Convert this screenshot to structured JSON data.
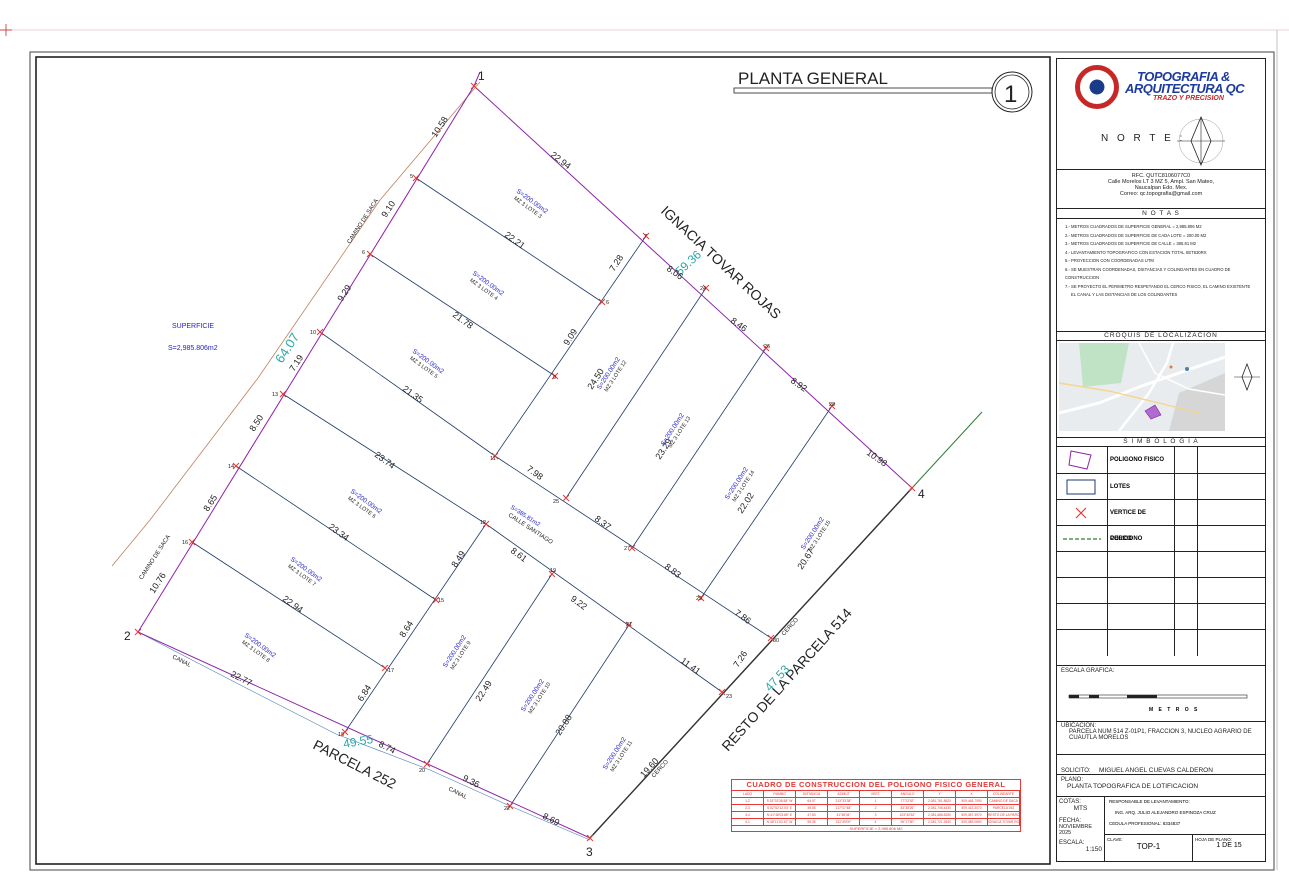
{
  "title": {
    "text": "PLANTA GENERAL",
    "number": "1"
  },
  "superficie": {
    "label": "SUPERFICIE",
    "value": "S=2,985.806m2"
  },
  "streets": {
    "north": "IGNACIA TOVAR ROJAS",
    "east": "RESTO DE LA PARCELA 514",
    "south": "PARCELA 252",
    "camino_upper": "CAMINO DE SACA",
    "camino_lower": "CAMINO DE SACA",
    "canal_1": "CANAL",
    "canal_2": "CANAL",
    "cerco_1": "CERCO",
    "cerco_2": "CERCO",
    "calle": "S=385.81m2",
    "calle_name": "CALLE SANTIAGO"
  },
  "big_dims": {
    "west": "64.07",
    "north": "59.36",
    "east": "47.53",
    "south": "49.55"
  },
  "corners": [
    "1",
    "2",
    "3",
    "4"
  ],
  "small_vertices": [
    "5",
    "6",
    "7",
    "6",
    "10",
    "9",
    "13",
    "11",
    "14",
    "12",
    "15",
    "16",
    "17",
    "18",
    "19",
    "20",
    "21",
    "22",
    "23",
    "24",
    "25",
    "26",
    "27",
    "28",
    "29",
    "30"
  ],
  "dims": [
    "10.58",
    "22.94",
    "9.10",
    "22.21",
    "7.28",
    "8.06",
    "9.29",
    "21.78",
    "9.09",
    "8.46",
    "7.19",
    "21.35",
    "24.50",
    "8.92",
    "8.50",
    "23.74",
    "7.98",
    "23.29",
    "10.98",
    "8.65",
    "23.34",
    "8.37",
    "22.02",
    "8.49",
    "8.61",
    "8.83",
    "20.67",
    "10.76",
    "22.94",
    "9.22",
    "7.86",
    "8.64",
    "11.41",
    "7.26",
    "22.77",
    "6.84",
    "22.49",
    "20.88",
    "8.74",
    "9.36",
    "8.69",
    "19.60"
  ],
  "lots": [
    {
      "area": "S=200.00m2",
      "name": "MZ 3 LOTE 3"
    },
    {
      "area": "S=200.00m2",
      "name": "MZ 3 LOTE 4"
    },
    {
      "area": "S=200.00m2",
      "name": "MZ 3 LOTE 5"
    },
    {
      "area": "S=200.00m2",
      "name": "MZ 3 LOTE 6"
    },
    {
      "area": "S=200.00m2",
      "name": "MZ 3 LOTE 7"
    },
    {
      "area": "S=200.00m2",
      "name": "MZ 3 LOTE 8"
    },
    {
      "area": "S=200.00m2",
      "name": "MZ 3 LOTE 9"
    },
    {
      "area": "S=200.00m2",
      "name": "MZ 3 LOTE 10"
    },
    {
      "area": "S=200.00m2",
      "name": "MZ 3 LOTE 11"
    },
    {
      "area": "S=200.00m2",
      "name": "MZ 3 LOTE 12"
    },
    {
      "area": "S=200.00m2",
      "name": "MZ 3 LOTE 13"
    },
    {
      "area": "S=200.00m2",
      "name": "MZ 3 LOTE 14"
    },
    {
      "area": "S=200.00m2",
      "name": "MZ 3 LOTE 15"
    }
  ],
  "title_block": {
    "logo_line1": "TOPOGRAFIA &",
    "logo_line2": "ARQUITECTURA QC",
    "logo_tag": "TRAZO Y PRECISION",
    "north_label": "N O R T E :",
    "address": [
      "RFC. QUTC8106077C0",
      "Calle Morelos LT 3 MZ 5, Ampl. San Mateo,",
      "Naucalpan Edo. Mex.",
      "Correo: qc.topografia@gmail.com"
    ],
    "notes_header": "N O T A S",
    "notes": [
      "1.- METROS CUADRADOS DE SUPERFICIE GENERAL = 2,985.806 M2",
      "2.- METROS CUADRADOS DE SUPERFICIE DE CADA LOTE = 200.00 M2",
      "3.- METROS CUADRADOS DE SUPERFICIE DE CALLE = 385.81 M2",
      "4.- LEVANTAMIENTO TOPOGRAFICO CON ESTACION TOTAL SET630RX",
      "5.- PROYECCION CON COORDENADAS UTM",
      "6.- SE MUESTRAN COORDENADAS, DISTANCIAS Y COLINDANTES EN CUADRO DE CONSTRUCCION",
      "7.- SE PROYECTO EL PERIMETRO RESPETANDO EL CERCO FISICO, EL CAMINO EXISTENTE",
      "EL CANAL Y LAS DISTANCIAS DE LOS COLINDANTES"
    ],
    "croquis_header": "CROQUIS DE LOCALIZACION",
    "simbologia_header": "S I M B O L O G I A",
    "legend": [
      "POLIGONO FISICO",
      "LOTES",
      "VERTICE DE POLIGONO",
      "CERCO"
    ],
    "escala_grafica": "ESCALA GRAFICA:",
    "metros": "M E T R O S",
    "ubicacion_label": "UBICACION:",
    "ubicacion": "PARCELA NUM 514 Z-01P1, FRACCION 3, NUCLEO AGRARIO DE CUAUTLA MORELOS",
    "solicito_label": "SOLICITO:",
    "solicito": "MIGUEL ANGEL CUEVAS CALDERON",
    "plano_label": "PLANO:",
    "plano": "PLANTA TOPOGRAFICA DE LOTIFICACION",
    "cotas_label": "COTAS:",
    "cotas": "MTS",
    "fecha_label": "FECHA:",
    "fecha": "NOVIEMBRE 2025",
    "escala_label": "ESCALA:",
    "escala": "1:150",
    "resp_label": "RESPONSABLE DE LEVANTAMIENTO:",
    "resp": "ING. ARQ. JULIO ALEJANDRO ESPINOZA CRUZ",
    "cedula": "CEDULA PROFESIONAL: 8334837",
    "clave_label": "CLAVE:",
    "clave": "TOP-1",
    "hoja_label": "HOJA DE PLANO:",
    "hoja": "1 DE 15"
  },
  "construction_table": {
    "title": "CUADRO DE CONSTRUCCION DEL POLIGONO FISICO GENERAL",
    "columns": [
      "LADO",
      "RUMBO",
      "DISTANCIA",
      "AZIMUT",
      "VERT.",
      "ANGULO",
      "Y",
      "X",
      "COLINDANTE"
    ],
    "rows": [
      [
        "1-2",
        "S 33°33'38.58\" W",
        "64.07",
        "213°33'38\"",
        "1",
        "77°22'52\"",
        "2,081,761.8620",
        "509,448.7090",
        "CAMINO DE SACA"
      ],
      [
        "2-3",
        "S 62°52'12.04\" E",
        "49.55",
        "117°07'48\"",
        "2",
        "83°38'26\"",
        "2,081,708.4430",
        "509,413.3070",
        "PARCELA 252"
      ],
      [
        "3-4",
        "N 41°48'03.86\" E",
        "47.53",
        "41°48'04\"",
        "3",
        "103°40'52\"",
        "2,081,685.8250",
        "509,457.3970",
        "RESTO DE LA PARCELA 514"
      ],
      [
        "4-1",
        "N 48°11'00.10\" W",
        "59.36",
        "311°49'00\"",
        "4",
        "95°17'50\"",
        "2,081,721.2640",
        "509,489.0690",
        "IGNACIA TOVAR ROJAS"
      ]
    ],
    "footer": "SUPERFICIE = 2,985.806 M2"
  },
  "colors": {
    "boundary": "#8e24aa",
    "lots": "#1f3a6b",
    "vertex": "#e53935",
    "cerco": "#2e7d32",
    "teal": "#2aa8a8",
    "blue_text": "#2323c8",
    "camino": "#c08060"
  }
}
